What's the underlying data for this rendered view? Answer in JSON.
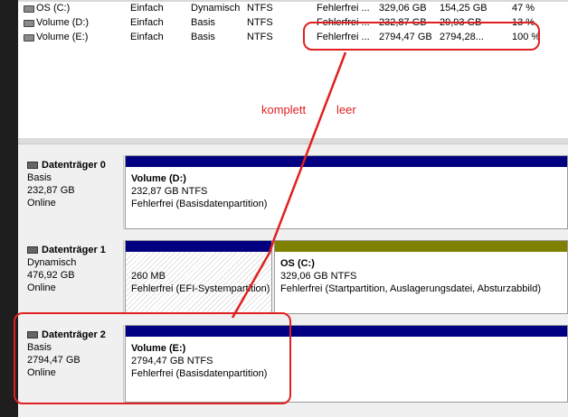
{
  "colors": {
    "basic_partition": "#000080",
    "primary_partition": "#808000",
    "annotation": "#e02020"
  },
  "volumes": [
    {
      "name": "OS (C:)",
      "layout": "Einfach",
      "type": "Dynamisch",
      "fs": "NTFS",
      "status": "Fehlerfrei ...",
      "capacity": "329,06 GB",
      "free": "154,25 GB",
      "pct": "47 %"
    },
    {
      "name": "Volume (D:)",
      "layout": "Einfach",
      "type": "Basis",
      "fs": "NTFS",
      "status": "Fehlerfrei ...",
      "capacity": "232,87 GB",
      "free": "29,93 GB",
      "pct": "13 %"
    },
    {
      "name": "Volume (E:)",
      "layout": "Einfach",
      "type": "Basis",
      "fs": "NTFS",
      "status": "Fehlerfrei ...",
      "capacity": "2794,47 GB",
      "free": "2794,28...",
      "pct": "100 %"
    }
  ],
  "annotation": {
    "word1": "komplett",
    "word2": "leer"
  },
  "disks": [
    {
      "name": "Datenträger 0",
      "kind": "Basis",
      "size": "232,87 GB",
      "state": "Online",
      "partitions": [
        {
          "title": "Volume  (D:)",
          "line1": "232,87 GB NTFS",
          "line2": "Fehlerfrei (Basisdatenpartition)"
        }
      ]
    },
    {
      "name": "Datenträger 1",
      "kind": "Dynamisch",
      "size": "476,92 GB",
      "state": "Online",
      "partitions": [
        {
          "title": "",
          "line1": "260 MB",
          "line2": "Fehlerfrei (EFI-Systempartition)"
        },
        {
          "title": "OS  (C:)",
          "line1": "329,06 GB NTFS",
          "line2": "Fehlerfrei (Startpartition, Auslagerungsdatei, Absturzabbild)"
        }
      ]
    },
    {
      "name": "Datenträger 2",
      "kind": "Basis",
      "size": "2794,47 GB",
      "state": "Online",
      "partitions": [
        {
          "title": "Volume  (E:)",
          "line1": "2794,47 GB NTFS",
          "line2": "Fehlerfrei (Basisdatenpartition)"
        }
      ]
    }
  ]
}
